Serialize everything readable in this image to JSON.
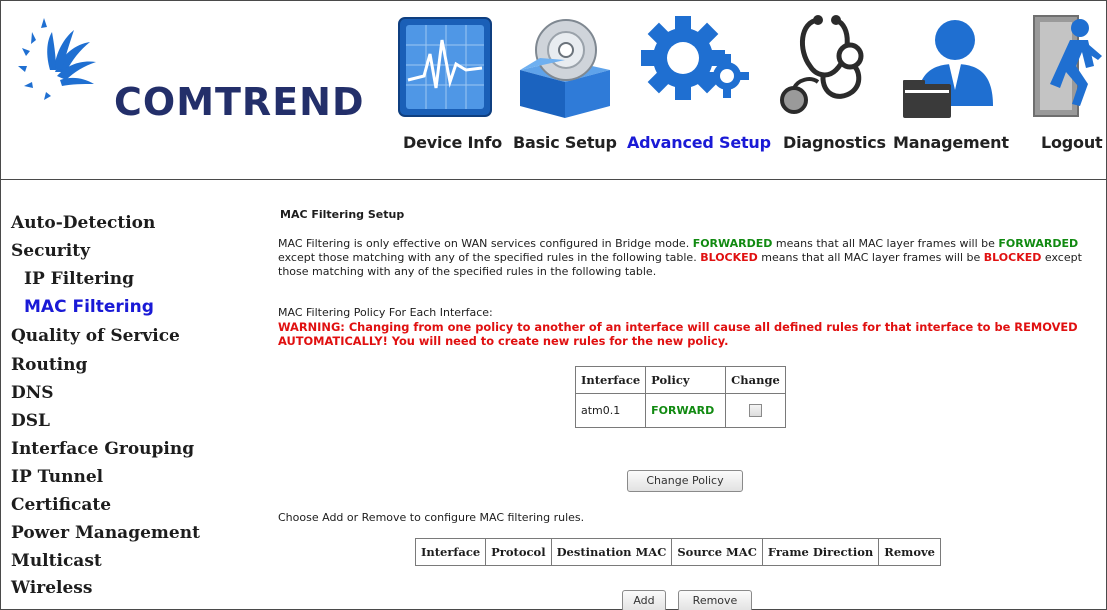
{
  "brand": {
    "name": "COMTREND"
  },
  "nav": {
    "device_info": "Device Info",
    "basic_setup": "Basic Setup",
    "advanced_setup": "Advanced Setup",
    "diagnostics": "Diagnostics",
    "management": "Management",
    "logout": "Logout"
  },
  "sidebar": {
    "items": [
      "Auto-Detection",
      "Security",
      "IP Filtering",
      "MAC Filtering",
      "Quality of Service",
      "Routing",
      "DNS",
      "DSL",
      "Interface Grouping",
      "IP Tunnel",
      "Certificate",
      "Power Management",
      "Multicast",
      "Wireless"
    ]
  },
  "content": {
    "title": "MAC Filtering Setup",
    "desc_1": "MAC Filtering is only effective on WAN services configured in Bridge mode.",
    "forwarded": "FORWARDED",
    "desc_2": "means that all MAC layer frames will be",
    "desc_3": "except those matching with any of the specified rules in the following table.",
    "blocked": "BLOCKED",
    "desc_4": "means that all MAC layer frames will be",
    "desc_5": "except those matching with any of the specified rules in the following table.",
    "policy_label": "MAC Filtering Policy For Each Interface:",
    "warning": "WARNING: Changing from one policy to another of an interface will cause all defined rules for that interface to be REMOVED AUTOMATICALLY! You will need to create new rules for the new policy.",
    "policy_table": {
      "headers": [
        "Interface",
        "Policy",
        "Change"
      ],
      "rows": [
        {
          "interface": "atm0.1",
          "policy": "FORWARD"
        }
      ]
    },
    "change_policy_button": "Change Policy",
    "choose_text": "Choose Add or Remove to configure MAC filtering rules.",
    "rules_table": {
      "headers": [
        "Interface",
        "Protocol",
        "Destination MAC",
        "Source MAC",
        "Frame Direction",
        "Remove"
      ]
    },
    "add_button": "Add",
    "remove_button": "Remove"
  },
  "colors": {
    "accent": "#1a1ad6",
    "forward_green": "#118a11",
    "warning_red": "#e01010",
    "logo_navy": "#232f6a",
    "icon_blue": "#1f6fd1"
  }
}
